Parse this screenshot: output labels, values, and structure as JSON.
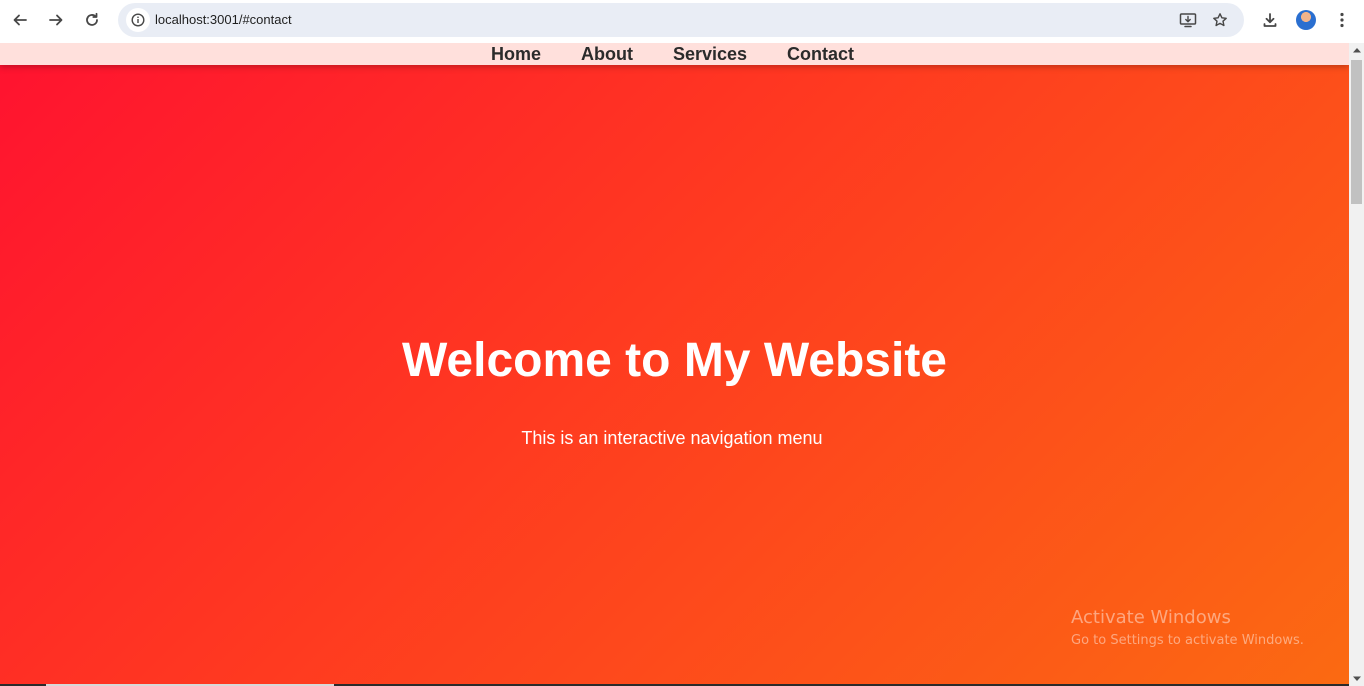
{
  "browser": {
    "url": "localhost:3001/#contact",
    "icons": {
      "back": "back-arrow-icon",
      "forward": "forward-arrow-icon",
      "reload": "reload-icon",
      "site_info": "info-icon",
      "install": "install-app-icon",
      "bookmark": "star-icon",
      "download": "download-icon",
      "profile": "avatar",
      "menu": "kebab-menu-icon"
    }
  },
  "site": {
    "nav": {
      "home": "Home",
      "about": "About",
      "services": "Services",
      "contact": "Contact"
    },
    "hero": {
      "title": "Welcome to My Website",
      "subtitle": "This is an interactive navigation menu"
    },
    "colors": {
      "gradient_start": "#ff1230",
      "gradient_end": "#fb6a12",
      "nav_background": "#ffe0dc"
    }
  },
  "os_watermark": {
    "title": "Activate Windows",
    "subtitle": "Go to Settings to activate Windows."
  }
}
